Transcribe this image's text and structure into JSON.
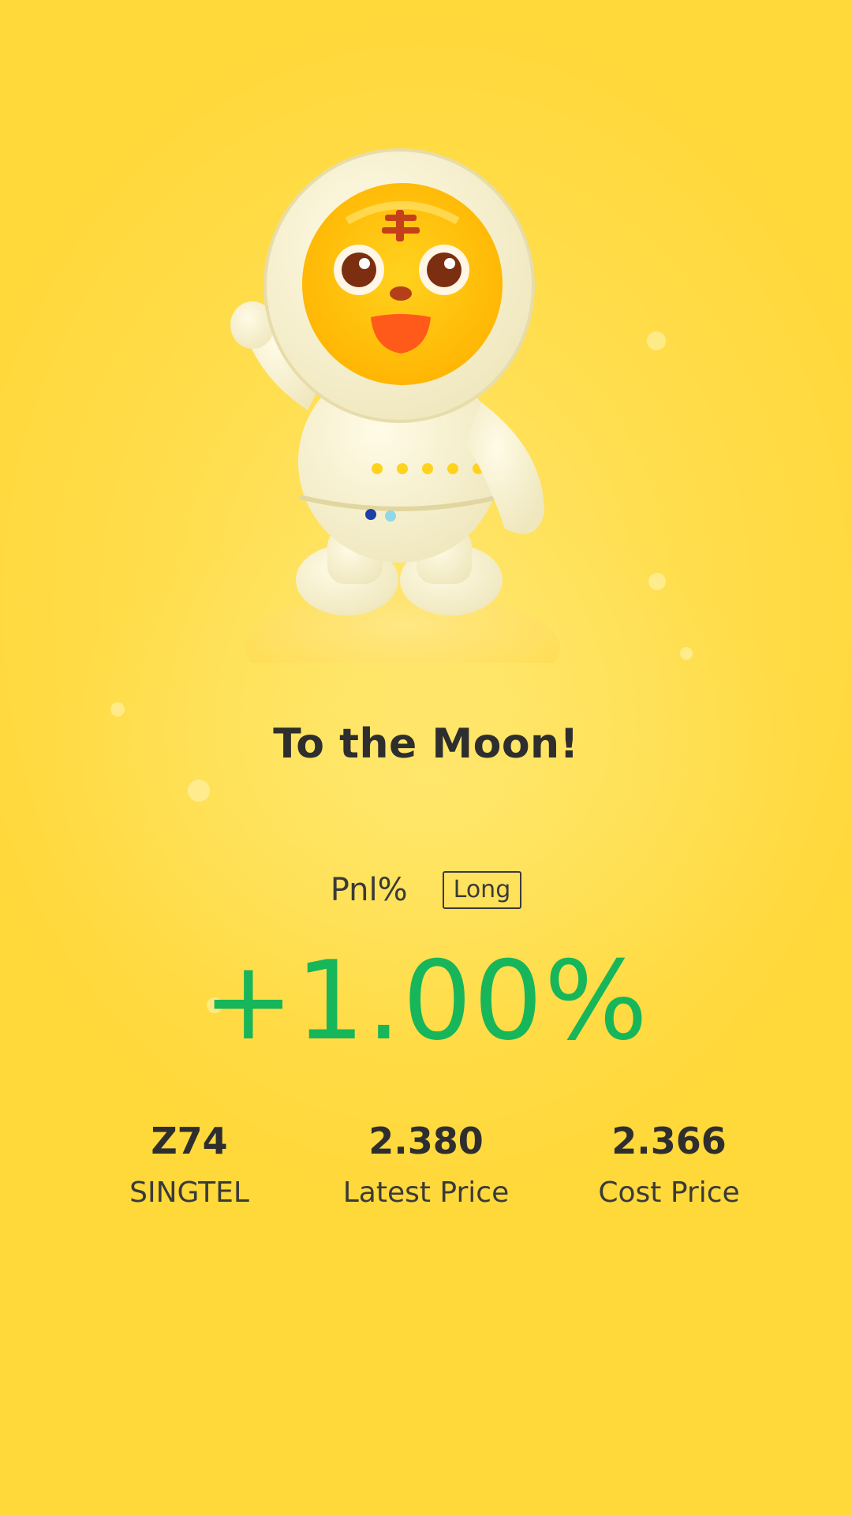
{
  "header": {
    "title": "To the Moon!"
  },
  "pnl": {
    "label": "Pnl%",
    "position_badge": "Long",
    "value": "+1.00%",
    "value_color": "#17b65a"
  },
  "stats": [
    {
      "value": "Z74",
      "label": "SINGTEL"
    },
    {
      "value": "2.380",
      "label": "Latest Price"
    },
    {
      "value": "2.366",
      "label": "Cost Price"
    }
  ],
  "mascot": {
    "icon": "tiger-astronaut-mascot-icon"
  },
  "theme": {
    "background": "#ffdd4c",
    "text": "#2e2e2e"
  }
}
